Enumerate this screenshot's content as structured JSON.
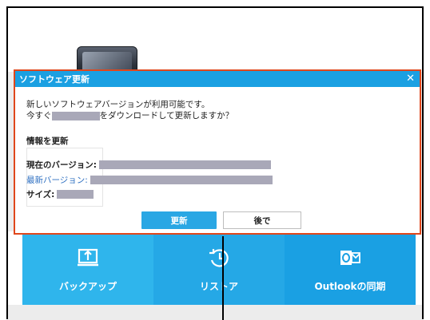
{
  "dialog": {
    "title": "ソフトウェア更新",
    "close_glyph": "✕",
    "message_line1": "新しいソフトウェアバージョンが利用可能です。",
    "message_line2_pre": "今すぐ",
    "message_line2_post": "をダウンロードして更新しますか？",
    "info_section_title": "情報を更新",
    "current_version_label": "現在のバージョン:",
    "latest_version_label": "最新バージョン:",
    "size_label": "サイズ:",
    "update_button": "更新",
    "later_button": "後で"
  },
  "tiles": [
    {
      "label": "バックアップ",
      "icon": "backup-icon"
    },
    {
      "label": "リストア",
      "icon": "restore-icon"
    },
    {
      "label": "Outlookの同期",
      "icon": "outlook-icon"
    }
  ],
  "colors": {
    "title_bar": "#1ba0e2",
    "highlight_border": "#e0471c",
    "tile_blue": "#25a8e6",
    "link_blue": "#2d6fc1",
    "redaction": "#a9a8b8"
  }
}
